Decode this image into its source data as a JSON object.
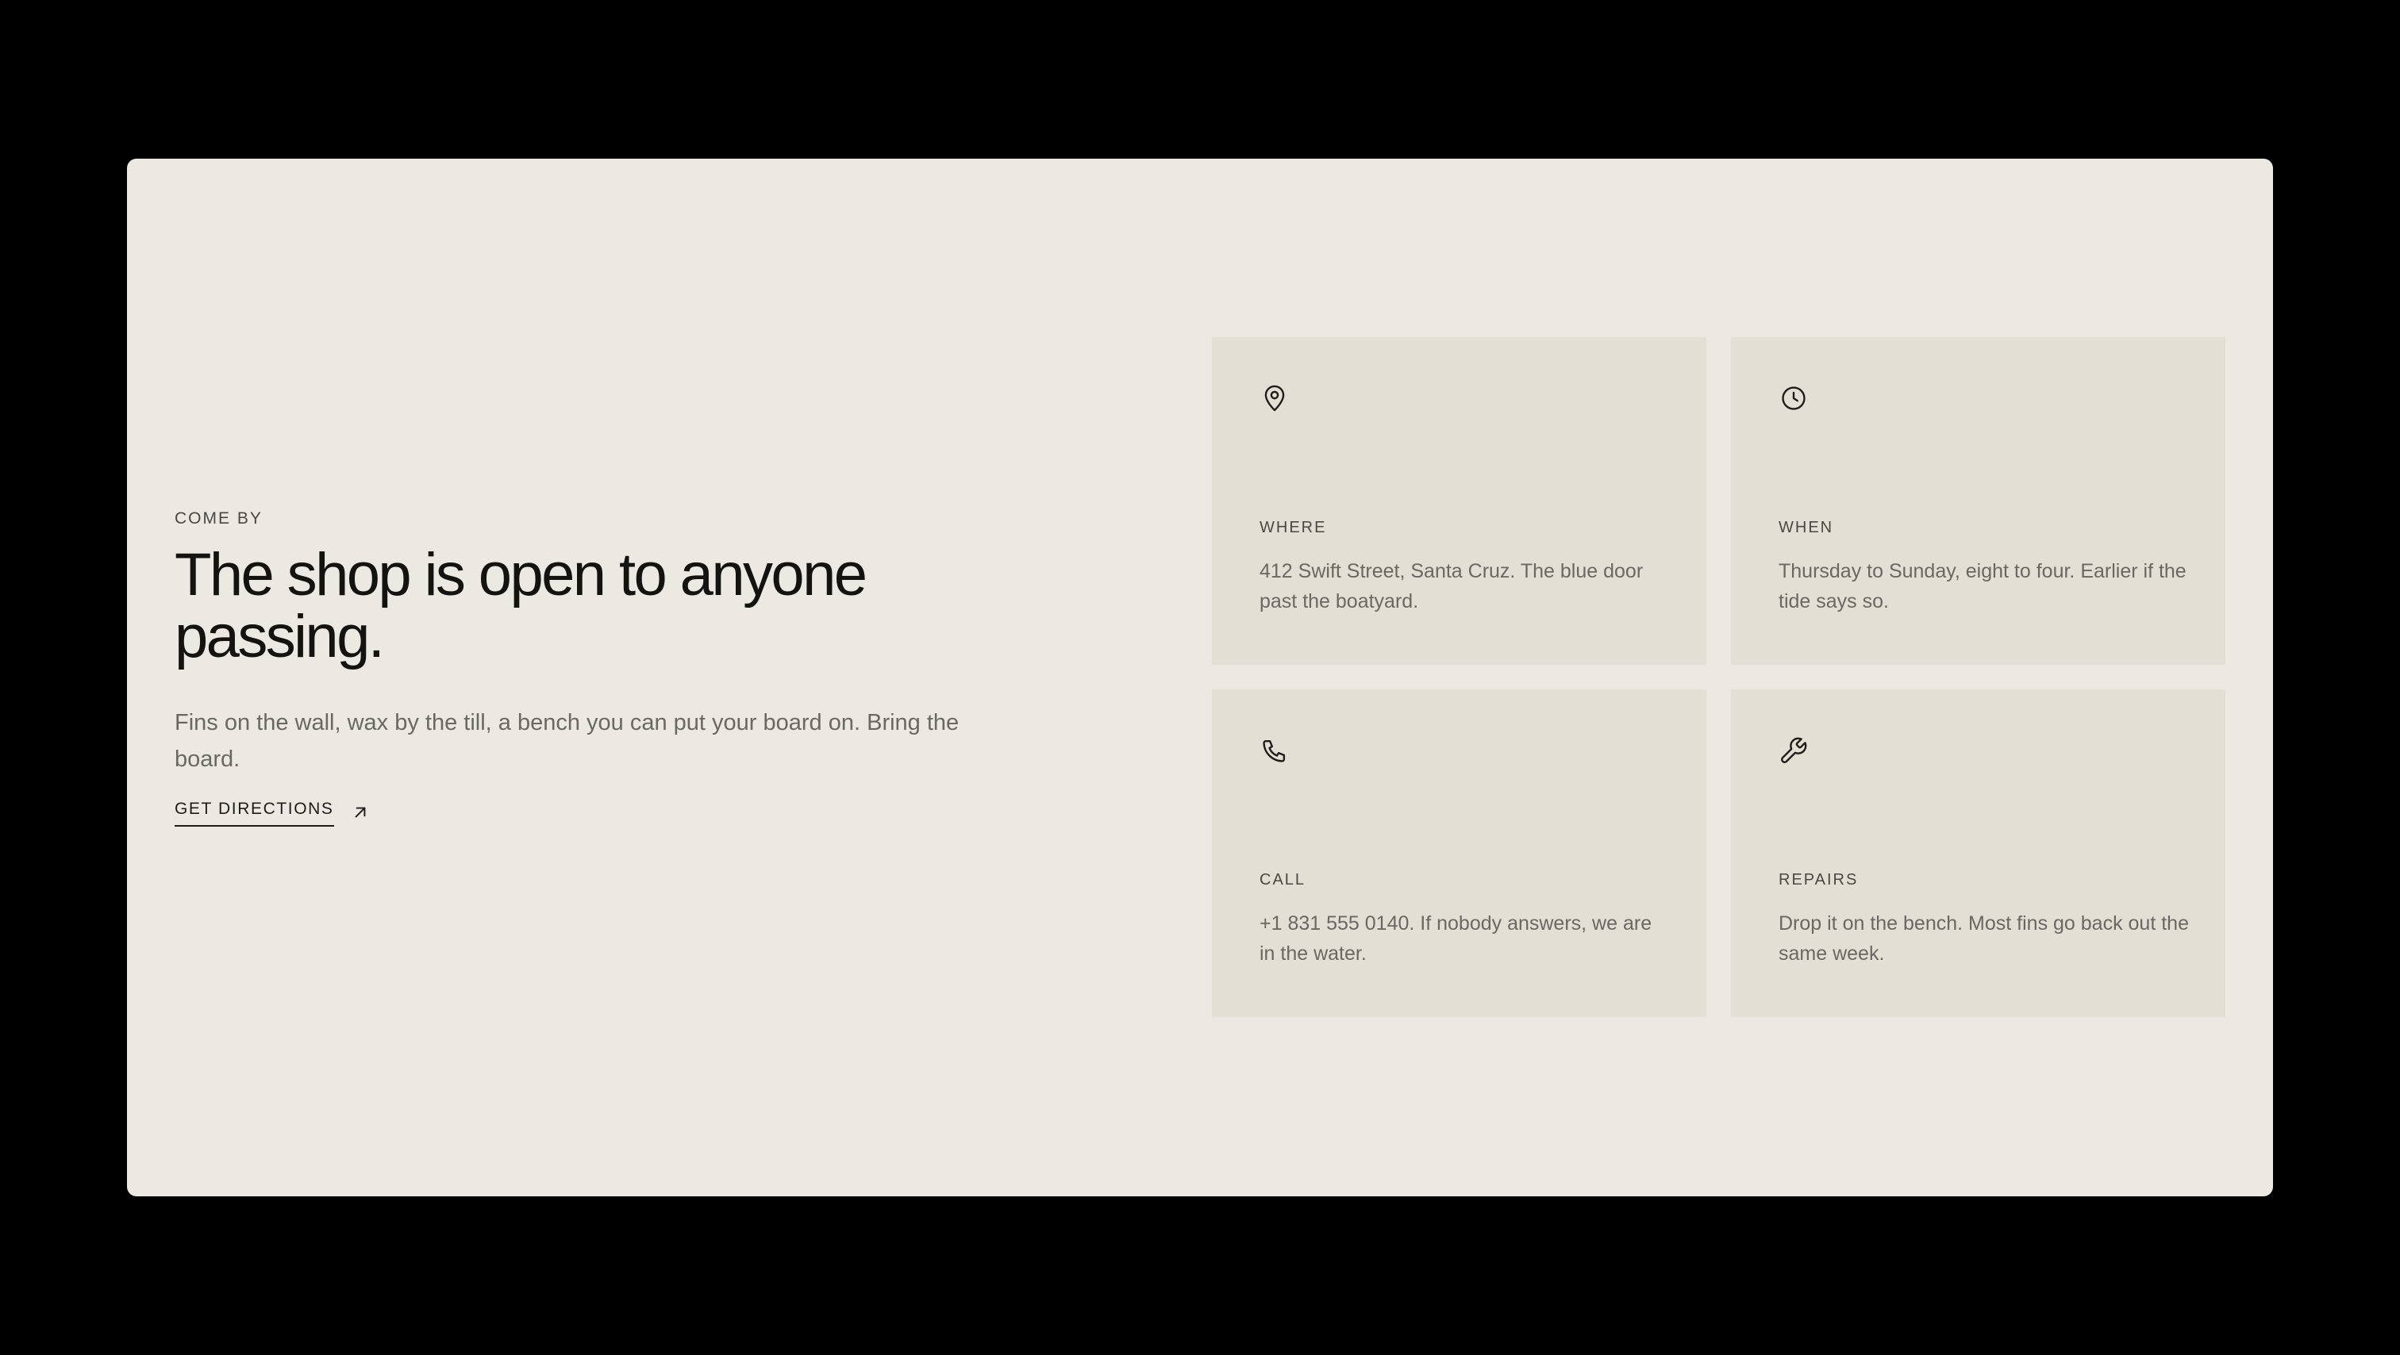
{
  "hero": {
    "eyebrow": "COME BY",
    "headline": "The shop is open to anyone passing.",
    "lead": "Fins on the wall, wax by the till, a bench you can put your board on. Bring the board.",
    "cta_label": "GET DIRECTIONS",
    "cta_icon": "arrow-up-right-icon"
  },
  "tiles": [
    {
      "icon": "map-pin-icon",
      "label": "WHERE",
      "text": "412 Swift Street, Santa Cruz. The blue door past the boatyard."
    },
    {
      "icon": "clock-icon",
      "label": "WHEN",
      "text": "Thursday to Sunday, eight to four. Earlier if the tide says so."
    },
    {
      "icon": "phone-icon",
      "label": "CALL",
      "text": "+1 831 555 0140. If nobody answers, we are in the water."
    },
    {
      "icon": "wrench-icon",
      "label": "REPAIRS",
      "text": "Drop it on the bench. Most fins go back out the same week."
    }
  ],
  "colors": {
    "page_background": "#000000",
    "card_background": "#ECE9E3",
    "tile_background": "#E2DFD4",
    "headline": "#141310",
    "body_text": "#6a6862"
  }
}
